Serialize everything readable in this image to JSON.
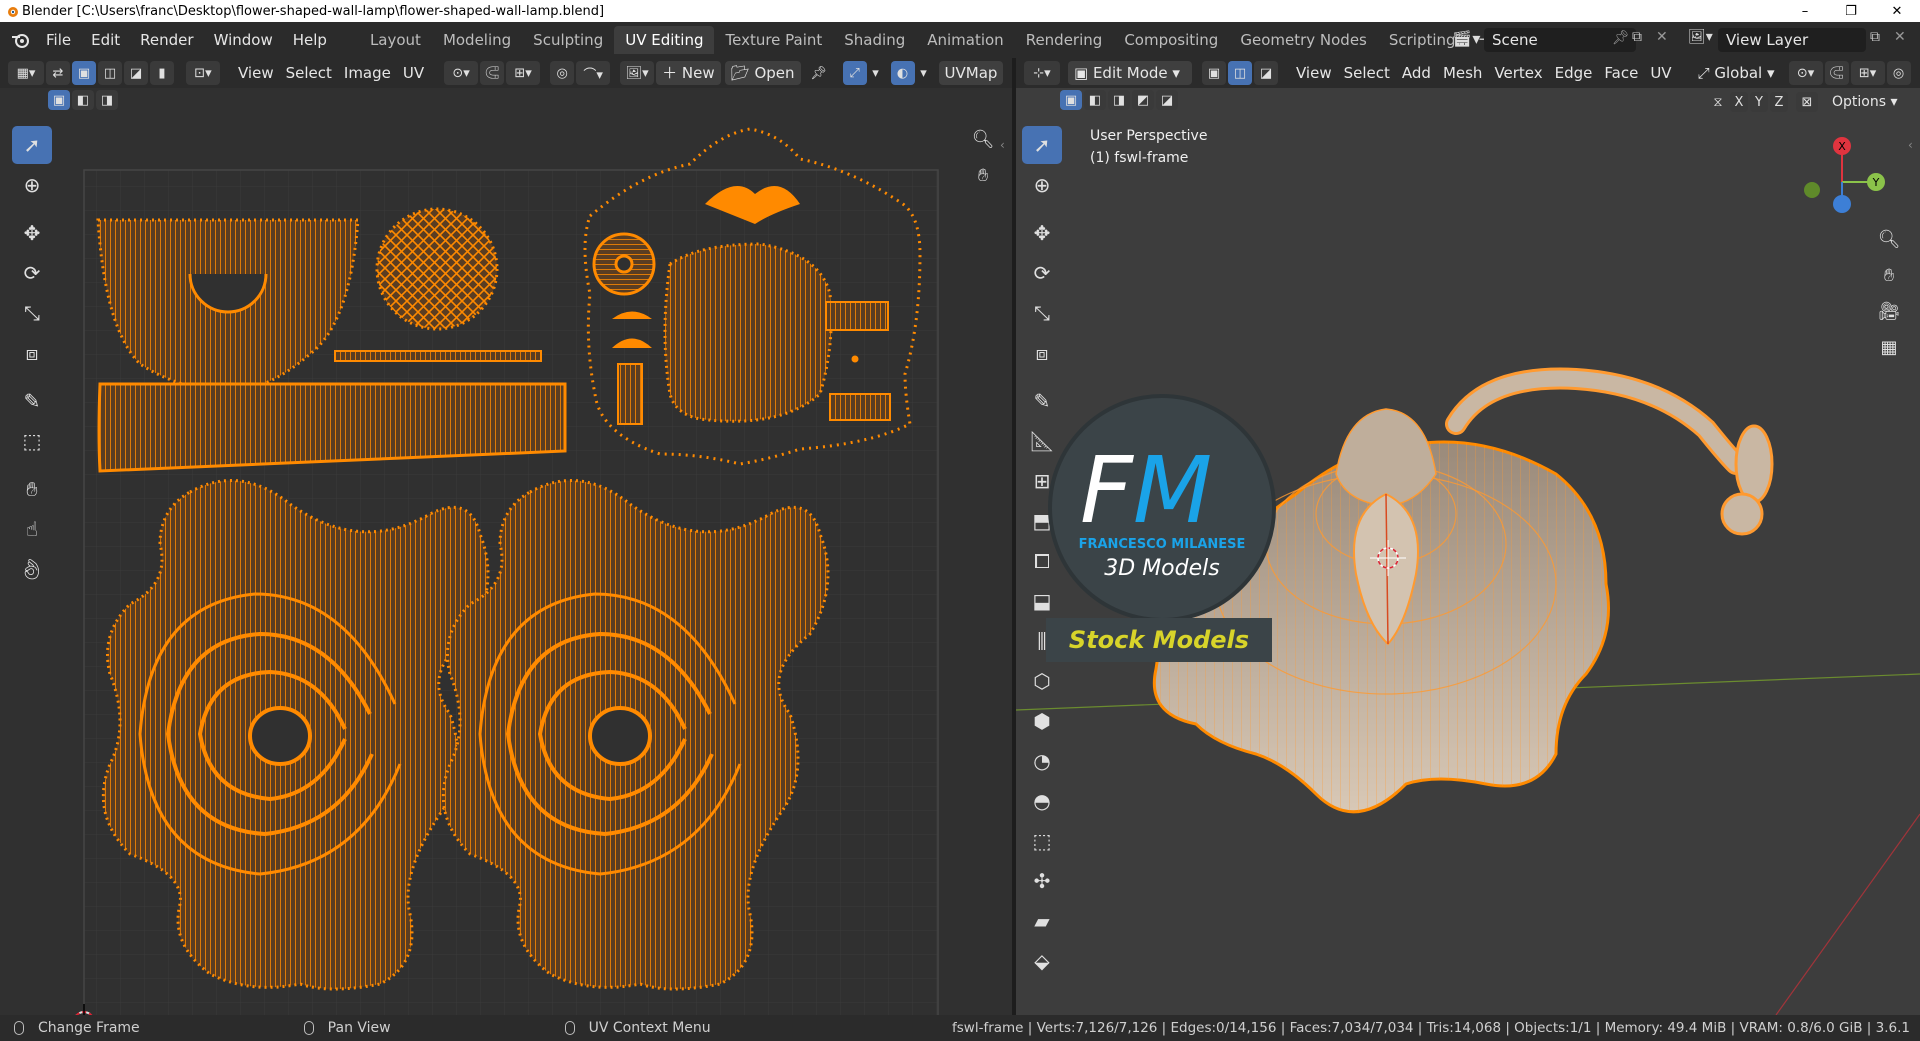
{
  "window": {
    "title": "Blender [C:\\Users\\franc\\Desktop\\flower-shaped-wall-lamp\\flower-shaped-wall-lamp.blend]",
    "minimize": "–",
    "maximize": "❐",
    "close": "✕"
  },
  "menus": [
    "File",
    "Edit",
    "Render",
    "Window",
    "Help"
  ],
  "workspaces": [
    "Layout",
    "Modeling",
    "Sculpting",
    "UV Editing",
    "Texture Paint",
    "Shading",
    "Animation",
    "Rendering",
    "Compositing",
    "Geometry Nodes",
    "Scripting"
  ],
  "active_workspace": "UV Editing",
  "add_workspace": "+",
  "scene": {
    "label": "Scene",
    "view_layer": "View Layer"
  },
  "uv_editor": {
    "menus": [
      "View",
      "Select",
      "Image",
      "UV"
    ],
    "new_label": "New",
    "open_label": "Open",
    "uvmap_label": "UVMap"
  },
  "viewport": {
    "mode_label": "Edit Mode",
    "menus": [
      "View",
      "Select",
      "Add",
      "Mesh",
      "Vertex",
      "Edge",
      "Face",
      "UV"
    ],
    "orientation_label": "Global",
    "options_label": "Options",
    "axes": [
      "X",
      "Y",
      "Z"
    ],
    "perspective": "User Perspective",
    "object": "(1) fswl-frame",
    "gizmo": {
      "x_label": "X",
      "y_label": "Y",
      "x_color": "#e0343f",
      "y_color": "#8bc34a",
      "z_color": "#3d7fd6"
    }
  },
  "watermark": {
    "brand": "FM",
    "name": "FRANCESCO MILANESE",
    "sub": "3D Models",
    "banner": "Stock Models"
  },
  "status": {
    "left": [
      "Change Frame",
      "Pan View",
      "UV Context Menu"
    ],
    "right": "fswl-frame | Verts:7,126/7,126 | Edges:0/14,156 | Faces:7,034/7,034 | Tris:14,068 | Objects:1/1 | Memory: 49.4 MiB | VRAM: 0.8/6.0 GiB | 3.6.1"
  },
  "colors": {
    "accent": "#4772b3",
    "selection": "#ff8a00",
    "bg_editor": "#303030"
  }
}
